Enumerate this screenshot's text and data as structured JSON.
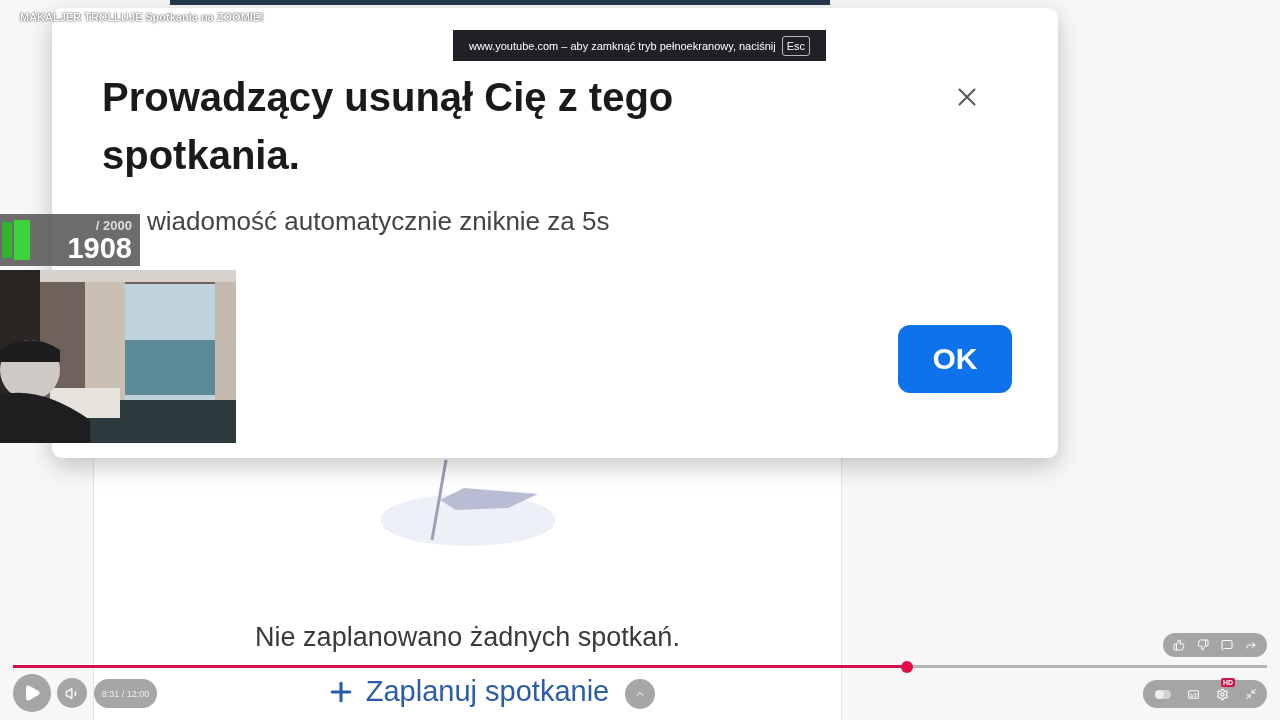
{
  "video_title": "MAKALJER TROLLUJE Spotkania na ZOOMIE!",
  "fullscreen_notice": {
    "text": "www.youtube.com – aby zamknąć tryb pełnoekranowy, naciśnij",
    "key": "Esc"
  },
  "dialog": {
    "title": "Prowadzący usunął Cię z tego spotkania.",
    "message": "wiadomość automatycznie zniknie za 5s",
    "button": "OK"
  },
  "counter": {
    "total": "/ 2000",
    "value": "1908"
  },
  "meetings": {
    "empty_text": "Nie zaplanowano żadnych spotkań.",
    "schedule_button": "Zaplanuj spotkanie"
  },
  "player": {
    "progress": {
      "level": 0.713
    },
    "time": "8:31 / 12:00",
    "hd_badge": "HD",
    "autoplay": {
      "on": false
    }
  }
}
